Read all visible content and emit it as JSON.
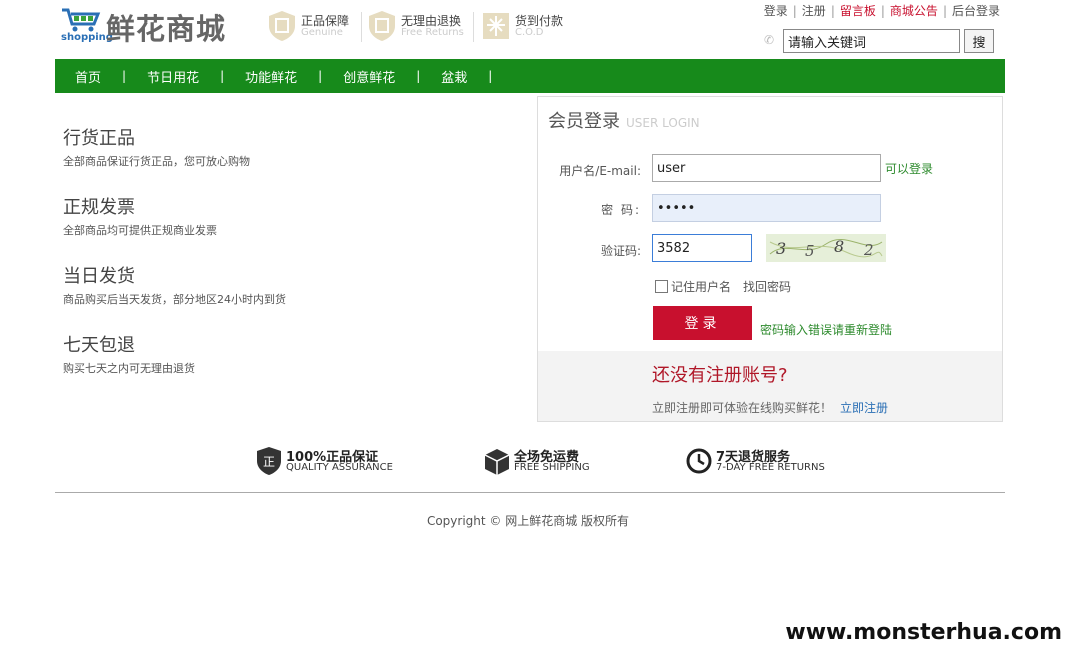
{
  "header": {
    "logo_shop": "shopping",
    "logo_title": "鲜花商城",
    "promises": [
      {
        "title": "正品保障",
        "sub": "Genuine"
      },
      {
        "title": "无理由退换",
        "sub": "Free Returns"
      },
      {
        "title": "货到付款",
        "sub": "C.O.D"
      }
    ],
    "top_links": [
      "登录",
      "注册",
      "留言板",
      "商城公告",
      "后台登录"
    ],
    "search_value": "请输入关键词",
    "search_button": "搜"
  },
  "nav": {
    "items": [
      "首页",
      "节日用花",
      "功能鲜花",
      "创意鲜花",
      "盆栽"
    ],
    "divider": "|"
  },
  "features": [
    {
      "title": "行货正品",
      "desc": "全部商品保证行货正品，您可放心购物"
    },
    {
      "title": "正规发票",
      "desc": "全部商品均可提供正规商业发票"
    },
    {
      "title": "当日发货",
      "desc": "商品购买后当天发货，部分地区24小时内到货"
    },
    {
      "title": "七天包退",
      "desc": "购买七天之内可无理由退货"
    }
  ],
  "login": {
    "title_cn": "会员登录",
    "title_en": "USER LOGIN",
    "username_label": "用户名/E-mail:",
    "username_value": "user",
    "username_status": "可以登录",
    "password_label": "密  码:",
    "password_value": "•••••",
    "code_label": "验证码:",
    "code_value": "3582",
    "captcha_chars": [
      "3",
      "5",
      "8",
      "2"
    ],
    "remember_label": "记住用户名",
    "find_password": "找回密码",
    "submit_label": "登录",
    "error_text": "密码输入错误请重新登陆",
    "register_question": "还没有注册账号?",
    "register_tip": "立即注册即可体验在线购买鲜花！",
    "register_link": "立即注册"
  },
  "guarantees": [
    {
      "title": "100%正品保证",
      "sub": "QUALITY ASSURANCE",
      "icon": "shield-icon",
      "glyph": "正"
    },
    {
      "title": "全场免运费",
      "sub": "FREE SHIPPING",
      "icon": "box-icon"
    },
    {
      "title": "7天退货服务",
      "sub": "7-DAY FREE RETURNS",
      "icon": "clock-icon"
    }
  ],
  "footer": {
    "copyright": "Copyright © 网上鲜花商城 版权所有"
  },
  "watermark": "www.monsterhua.com",
  "colors": {
    "nav_green": "#178a1b",
    "login_red": "#c8102e",
    "status_green": "#2e8b2e",
    "link_blue": "#2a6fb5"
  }
}
